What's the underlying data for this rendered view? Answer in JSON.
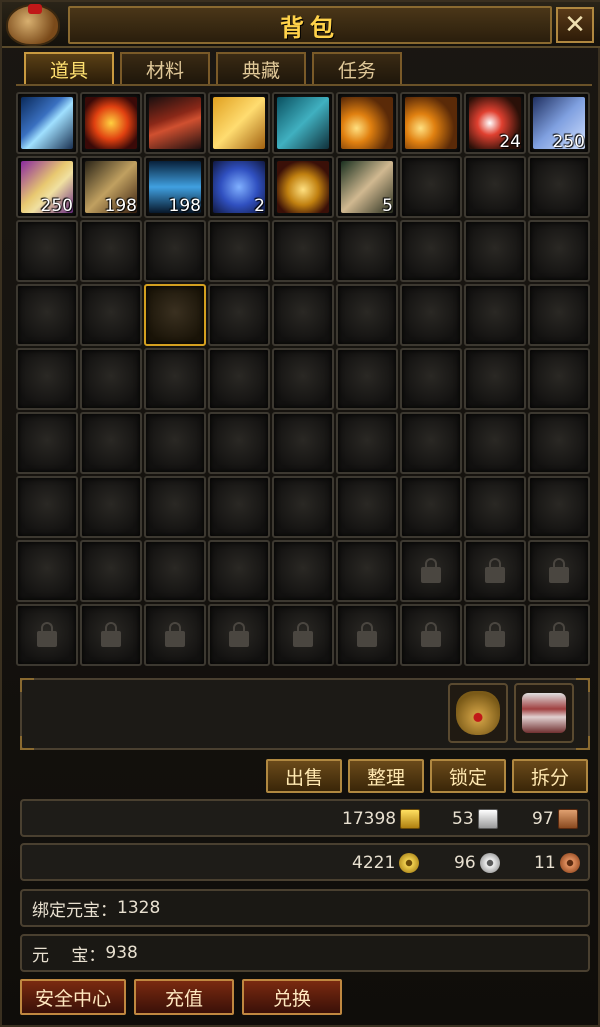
{
  "window": {
    "title": "背包",
    "close_label": "✕"
  },
  "tabs": [
    {
      "label": "道具",
      "active": true
    },
    {
      "label": "材料",
      "active": false
    },
    {
      "label": "典藏",
      "active": false
    },
    {
      "label": "任务",
      "active": false
    }
  ],
  "grid": {
    "columns": 9,
    "rows": 9,
    "selected_index": 29,
    "locked_from_index": 69,
    "items": [
      {
        "icon": "magic-staff-icon",
        "style": "it-staff",
        "qty": ""
      },
      {
        "icon": "fire-charm-icon",
        "style": "it-fire",
        "qty": ""
      },
      {
        "icon": "red-tube-icon",
        "style": "it-tube",
        "qty": ""
      },
      {
        "icon": "golden-book-icon",
        "style": "it-book",
        "qty": ""
      },
      {
        "icon": "talisman-icon",
        "style": "it-talisman",
        "qty": ""
      },
      {
        "icon": "gold-ingots-icon",
        "style": "it-gold",
        "qty": ""
      },
      {
        "icon": "gold-ingots-icon",
        "style": "it-gold",
        "qty": ""
      },
      {
        "icon": "orbs-icon",
        "style": "it-orbs",
        "qty": "24"
      },
      {
        "icon": "blue-flag-icon",
        "style": "it-flag",
        "qty": "250"
      },
      {
        "icon": "scroll-icon",
        "style": "it-scroll",
        "qty": "250"
      },
      {
        "icon": "sword-icon",
        "style": "it-sword",
        "qty": "198"
      },
      {
        "icon": "blue-light-icon",
        "style": "it-blue",
        "qty": "198"
      },
      {
        "icon": "crystal-icon",
        "style": "it-crystal",
        "qty": "2"
      },
      {
        "icon": "gourd-icon",
        "style": "it-gourd",
        "qty": ""
      },
      {
        "icon": "rolled-scroll-icon",
        "style": "it-roll",
        "qty": "5"
      }
    ]
  },
  "action_buttons": {
    "sell": "出售",
    "sort": "整理",
    "lock": "锁定",
    "split": "拆分"
  },
  "currency_row1": {
    "gold_ingot": "17398",
    "silver_ingot": "53",
    "copper_ingot": "97"
  },
  "currency_row2": {
    "gold_coin": "4221",
    "silver_coin": "96",
    "copper_coin": "11"
  },
  "bound_yuanbao": {
    "label": "绑定元宝：",
    "value": "1328"
  },
  "yuanbao": {
    "label": "元　 宝：",
    "value": "938"
  },
  "bottom_buttons": {
    "security": "安全中心",
    "recharge": "充值",
    "exchange": "兑换"
  }
}
